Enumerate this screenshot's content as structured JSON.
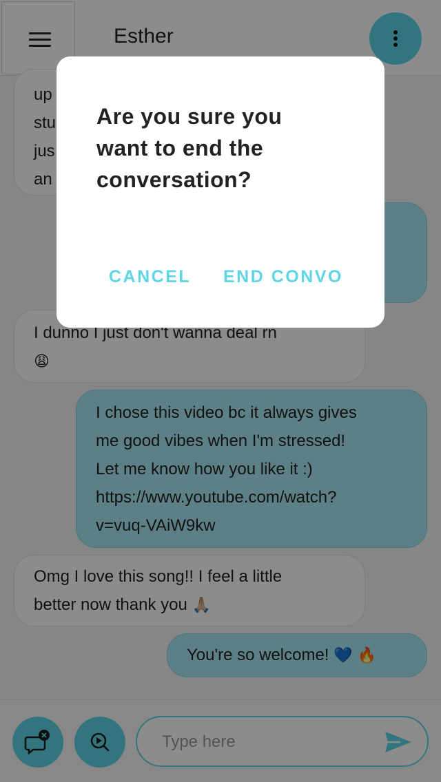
{
  "header": {
    "contact_name": "Esther"
  },
  "messages": [
    {
      "direction": "in",
      "lines": [
        "up",
        "stu",
        "jus",
        "an"
      ]
    },
    {
      "direction": "out",
      "lines": []
    },
    {
      "direction": "in",
      "lines": [
        "I dunno I just don't wanna deal rn"
      ],
      "emoji": "😩"
    },
    {
      "direction": "out",
      "lines": [
        "I chose this video bc it always gives",
        "me good vibes when I'm stressed!",
        "Let me know how you like it :)",
        "https://www.youtube.com/watch?",
        "v=vuq-VAiW9kw"
      ]
    },
    {
      "direction": "in",
      "lines": [
        "Omg I love this song!! I feel a little",
        "better now thank you"
      ],
      "emoji": "🙏🏼"
    },
    {
      "direction": "out",
      "lines": [
        "You're so welcome!"
      ],
      "emoji": "💙 🔥"
    }
  ],
  "composer": {
    "placeholder": "Type here",
    "value": ""
  },
  "dialog": {
    "title_lines": [
      "Are you sure you",
      "want to end the",
      "conversation?"
    ],
    "cancel_label": "CANCEL",
    "confirm_label": "END CONVO"
  },
  "icons": {
    "menu": "hamburger-menu-icon",
    "more": "more-vertical-icon",
    "end_chat": "chat-close-icon",
    "search_video": "search-play-icon",
    "send": "send-icon"
  },
  "colors": {
    "accent": "#5ed6e6",
    "outgoing_bubble": "#a8e9f2",
    "incoming_bubble": "#ffffff",
    "overlay": "rgba(0,0,0,0.45)"
  }
}
